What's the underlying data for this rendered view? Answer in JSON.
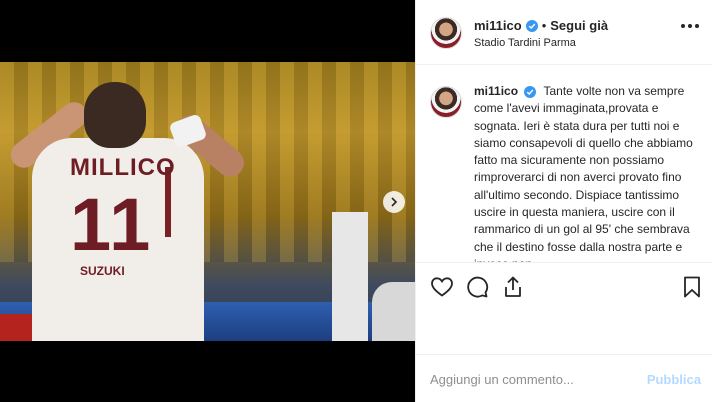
{
  "header": {
    "username": "mi11ico",
    "separator": "•",
    "follow_label": "Segui già",
    "location": "Stadio Tardini Parma"
  },
  "photo": {
    "shirt_name": "MILLICO",
    "shirt_number": "11",
    "shirt_sponsor": "SUZUKI"
  },
  "caption": {
    "username": "mi11ico",
    "text": "Tante volte non va sempre come l'avevi immaginata,provata e sognata. Ieri è stata dura per tutti noi e siamo consapevoli di quello che abbiamo fatto ma sicuramente non possiamo rimproverarci di non averci provato fino all'ultimo secondo. Dispiace tantissimo uscire in questa maniera, uscire con il rammarico di un gol al 95' che sembrava che il destino fosse dalla nostra parte e invece non"
  },
  "add_comment": {
    "placeholder": "Aggiungi un commento...",
    "publish_label": "Pubblica"
  },
  "colors": {
    "verified": "#3897f0",
    "publish_disabled": "#b3dbff",
    "divider": "#efefef"
  },
  "icons": {
    "next": "chevron-right-icon",
    "more": "more-options-icon",
    "like": "heart-icon",
    "comment": "comment-icon",
    "share": "share-icon",
    "save": "bookmark-icon"
  }
}
